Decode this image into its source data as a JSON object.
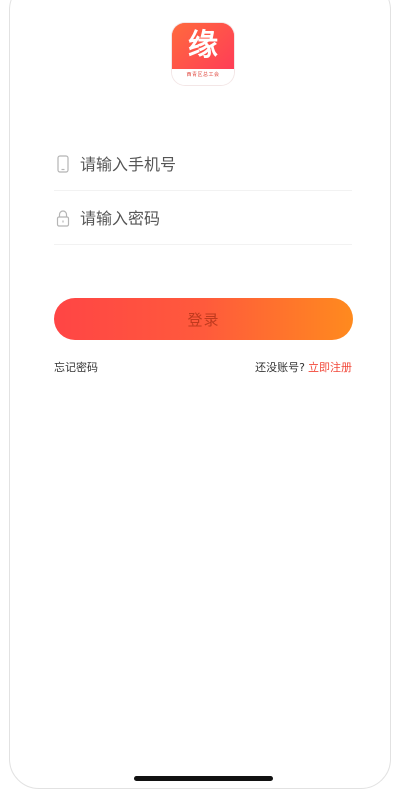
{
  "app": {
    "logo_char": "缘",
    "logo_subtitle": "西青区总工会",
    "brand_color": "#ff4a4a",
    "accent_end_color": "#ff8a1e"
  },
  "login_form": {
    "phone_placeholder": "请输入手机号",
    "phone_icon": "mobile-phone-icon",
    "password_placeholder": "请输入密码",
    "password_icon": "lock-icon",
    "login_button_label": "登录"
  },
  "links": {
    "forgot_password": "忘记密码",
    "no_account_prompt": "还没账号?",
    "register_now": "立即注册",
    "register_color": "#f2483a"
  }
}
